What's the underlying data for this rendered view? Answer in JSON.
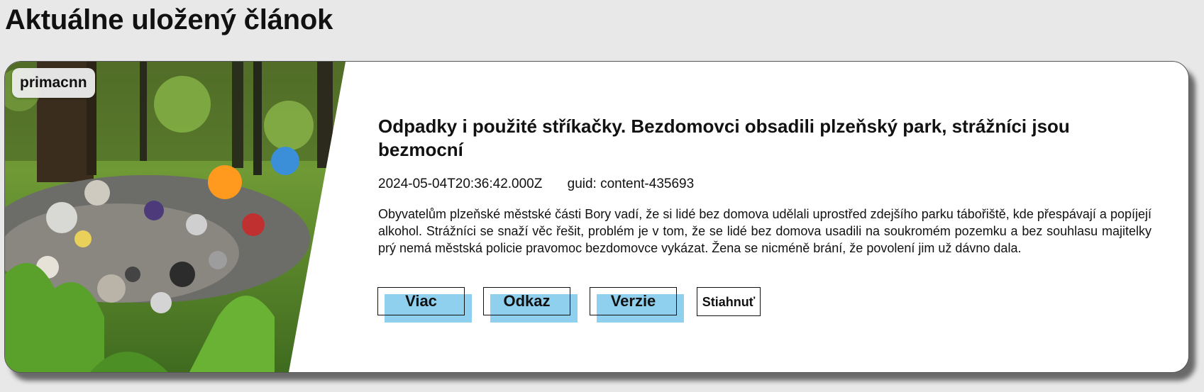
{
  "page": {
    "heading": "Aktuálne uložený článok"
  },
  "article": {
    "source": "primacnn",
    "title": "Odpadky i použité stříkačky. Bezdomovci obsadili plzeňský park, strážníci jsou bezmocní",
    "timestamp": "2024-05-04T20:36:42.000Z",
    "guid_label": "guid: content-435693",
    "description": "Obyvatelům plzeňské městské části Bory vadí, že si lidé bez domova udělali uprostřed zdejšího parku tábořiště, kde přespávají a popíjejí alkohol. Strážníci se snaží věc řešit, problém je v tom, že se lidé bez domova usadili na soukromém pozemku a bez souhlasu majitelky prý nemá městská policie pravomoc bezdomovce vykázat. Žena se nicméně brání, že povolení jim už dávno dala."
  },
  "buttons": {
    "more": "Viac",
    "link": "Odkaz",
    "versions": "Verzie",
    "download": "Stiahnuť"
  },
  "colors": {
    "page_background": "#e8e8e8",
    "button_accent": "#8fd0ee"
  }
}
